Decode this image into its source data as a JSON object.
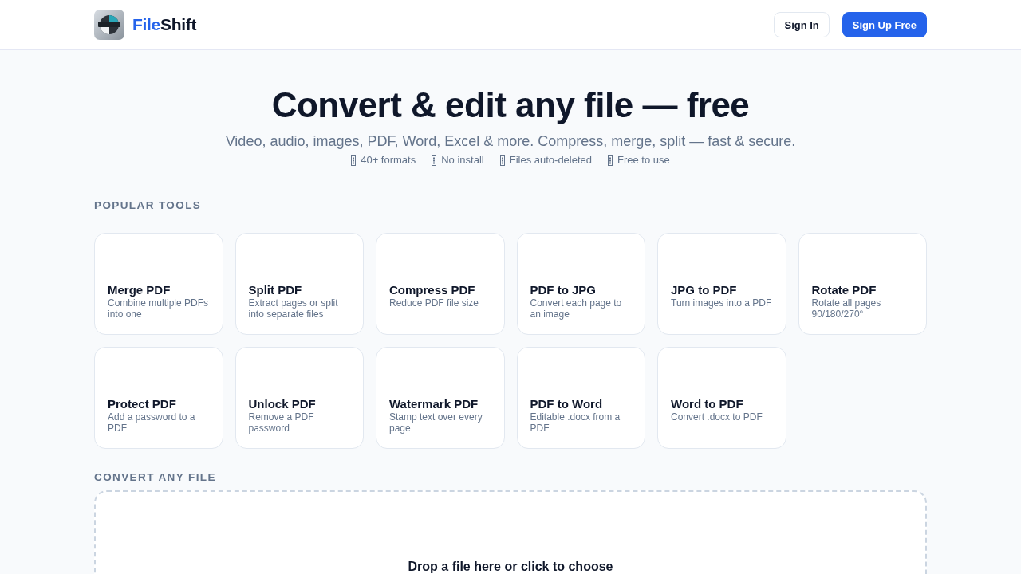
{
  "header": {
    "brand": [
      {
        "text": "File",
        "accent": true
      },
      {
        "text": "Shift",
        "accent": false
      }
    ],
    "buttons": [
      {
        "label": "Sign In",
        "kind": "outline"
      },
      {
        "label": "Sign Up Free",
        "kind": "primary"
      }
    ]
  },
  "hero": {
    "title": "Convert & edit any file — free",
    "subtitle": "Video, audio, images, PDF, Word, Excel & more. Compress, merge, split — fast & secure.",
    "features": [
      "40+ formats",
      "No install",
      "Files auto-deleted",
      "Free to use"
    ]
  },
  "popular_tools": {
    "heading": "POPULAR TOOLS",
    "tools": [
      {
        "name": "Merge PDF",
        "description": "Combine multiple PDFs into one"
      },
      {
        "name": "Split PDF",
        "description": "Extract pages or split into separate files"
      },
      {
        "name": "Compress PDF",
        "description": "Reduce PDF file size"
      },
      {
        "name": "PDF to JPG",
        "description": "Convert each page to an image"
      },
      {
        "name": "JPG to PDF",
        "description": "Turn images into a PDF"
      },
      {
        "name": "Rotate PDF",
        "description": "Rotate all pages 90/180/270°"
      },
      {
        "name": "Protect PDF",
        "description": "Add a password to a PDF"
      },
      {
        "name": "Unlock PDF",
        "description": "Remove a PDF password"
      },
      {
        "name": "Watermark PDF",
        "description": "Stamp text over every page"
      },
      {
        "name": "PDF to Word",
        "description": "Editable .docx from a PDF"
      },
      {
        "name": "Word to PDF",
        "description": "Convert .docx to PDF"
      }
    ]
  },
  "convert": {
    "heading": "CONVERT ANY FILE",
    "drop_zone": {
      "hint": "Drop a file here or click to choose"
    }
  }
}
